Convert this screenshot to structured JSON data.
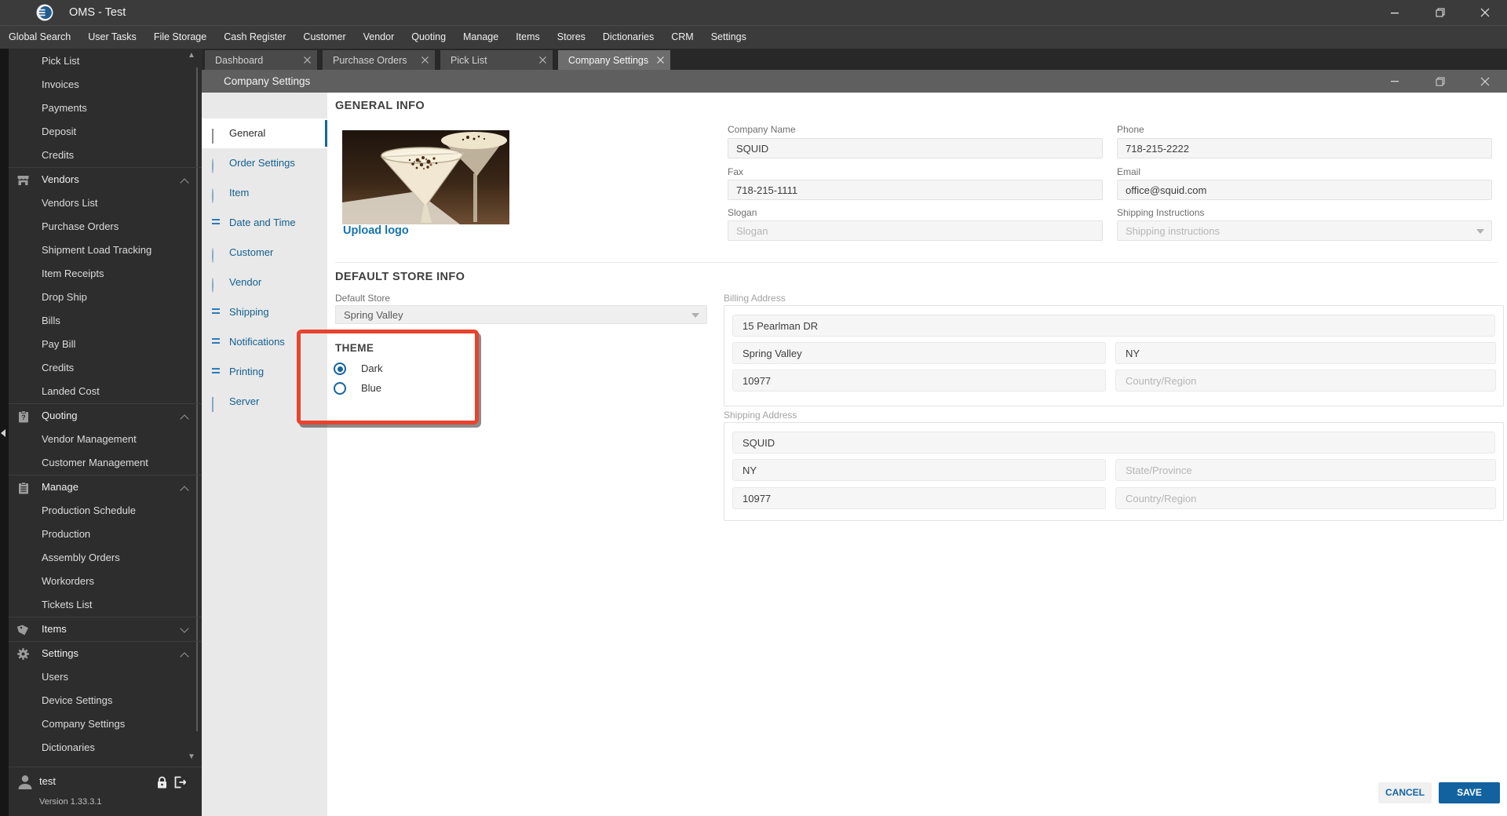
{
  "app": {
    "title": "OMS - Test",
    "user": "test",
    "version": "Version 1.33.3.1"
  },
  "menu": {
    "items": [
      "Global Search",
      "User Tasks",
      "File Storage",
      "Cash Register",
      "Customer",
      "Vendor",
      "Quoting",
      "Manage",
      "Items",
      "Stores",
      "Dictionaries",
      "CRM",
      "Settings"
    ]
  },
  "tabs": [
    {
      "label": "Dashboard",
      "active": false
    },
    {
      "label": "Purchase Orders",
      "active": false
    },
    {
      "label": "Pick List",
      "active": false
    },
    {
      "label": "Company Settings",
      "active": true
    }
  ],
  "sidebar": {
    "items": [
      {
        "label": "Pick List",
        "type": "sub"
      },
      {
        "label": "Invoices",
        "type": "sub"
      },
      {
        "label": "Payments",
        "type": "sub"
      },
      {
        "label": "Deposit",
        "type": "sub"
      },
      {
        "label": "Credits",
        "type": "sub"
      },
      {
        "label": "Vendors",
        "type": "group",
        "icon": "store-icon",
        "state": "expanded"
      },
      {
        "label": "Vendors List",
        "type": "sub"
      },
      {
        "label": "Purchase Orders",
        "type": "sub"
      },
      {
        "label": "Shipment Load Tracking",
        "type": "sub"
      },
      {
        "label": "Item Receipts",
        "type": "sub"
      },
      {
        "label": "Drop Ship",
        "type": "sub"
      },
      {
        "label": "Bills",
        "type": "sub"
      },
      {
        "label": "Pay Bill",
        "type": "sub"
      },
      {
        "label": "Credits",
        "type": "sub"
      },
      {
        "label": "Landed Cost",
        "type": "sub"
      },
      {
        "label": "Quoting",
        "type": "group",
        "icon": "quote-clipboard-icon",
        "state": "expanded"
      },
      {
        "label": "Vendor Management",
        "type": "sub"
      },
      {
        "label": "Customer Management",
        "type": "sub"
      },
      {
        "label": "Manage",
        "type": "group",
        "icon": "clipboard-icon",
        "state": "expanded"
      },
      {
        "label": "Production Schedule",
        "type": "sub"
      },
      {
        "label": "Production",
        "type": "sub"
      },
      {
        "label": "Assembly Orders",
        "type": "sub"
      },
      {
        "label": "Workorders",
        "type": "sub"
      },
      {
        "label": "Tickets List",
        "type": "sub"
      },
      {
        "label": "Items",
        "type": "group",
        "icon": "tag-icon",
        "state": "collapsed"
      },
      {
        "label": "Settings",
        "type": "group",
        "icon": "gear-icon",
        "state": "expanded"
      },
      {
        "label": "Users",
        "type": "sub"
      },
      {
        "label": "Device Settings",
        "type": "sub"
      },
      {
        "label": "Company Settings",
        "type": "sub"
      },
      {
        "label": "Dictionaries",
        "type": "sub"
      }
    ]
  },
  "panel": {
    "title": "Company Settings",
    "nav": [
      {
        "label": "General",
        "icon": "diamond",
        "active": true
      },
      {
        "label": "Order Settings",
        "icon": "circle",
        "active": false
      },
      {
        "label": "Item",
        "icon": "circle",
        "active": false
      },
      {
        "label": "Date and Time",
        "icon": "equals",
        "active": false
      },
      {
        "label": "Customer",
        "icon": "circle",
        "active": false
      },
      {
        "label": "Vendor",
        "icon": "circle",
        "active": false
      },
      {
        "label": "Shipping",
        "icon": "equals",
        "active": false
      },
      {
        "label": "Notifications",
        "icon": "equals",
        "active": false
      },
      {
        "label": "Printing",
        "icon": "equals",
        "active": false
      },
      {
        "label": "Server",
        "icon": "diamond",
        "active": false
      }
    ],
    "general": {
      "title": "GENERAL INFO",
      "upload_logo": "Upload logo",
      "company_name": {
        "label": "Company Name",
        "value": "SQUID"
      },
      "phone": {
        "label": "Phone",
        "value": "718-215-2222"
      },
      "fax": {
        "label": "Fax",
        "value": "718-215-1111"
      },
      "email": {
        "label": "Email",
        "value": "office@squid.com"
      },
      "slogan": {
        "label": "Slogan",
        "placeholder": "Slogan"
      },
      "shipping_instructions": {
        "label": "Shipping Instructions",
        "placeholder": "Shipping instructions"
      }
    },
    "store": {
      "title": "DEFAULT STORE INFO",
      "default_store": {
        "label": "Default Store",
        "value": "Spring Valley"
      },
      "theme": {
        "title": "THEME",
        "options": [
          {
            "label": "Dark",
            "selected": true
          },
          {
            "label": "Blue",
            "selected": false
          }
        ]
      }
    },
    "billing": {
      "label": "Billing Address",
      "street": "15 Pearlman DR",
      "city": "Spring Valley",
      "region": "NY",
      "zip": "10977",
      "country_placeholder": "Country/Region"
    },
    "shipping_addr": {
      "label": "Shipping Address",
      "name": "SQUID",
      "city": "NY",
      "state_placeholder": "State/Province",
      "zip": "10977",
      "country_placeholder": "Country/Region"
    },
    "footer": {
      "cancel": "CANCEL",
      "save": "SAVE"
    }
  },
  "colors": {
    "accent_blue": "#15639f",
    "link_blue": "#1673b1",
    "highlight_red": "#e8432e",
    "save_button": "#11629f"
  }
}
